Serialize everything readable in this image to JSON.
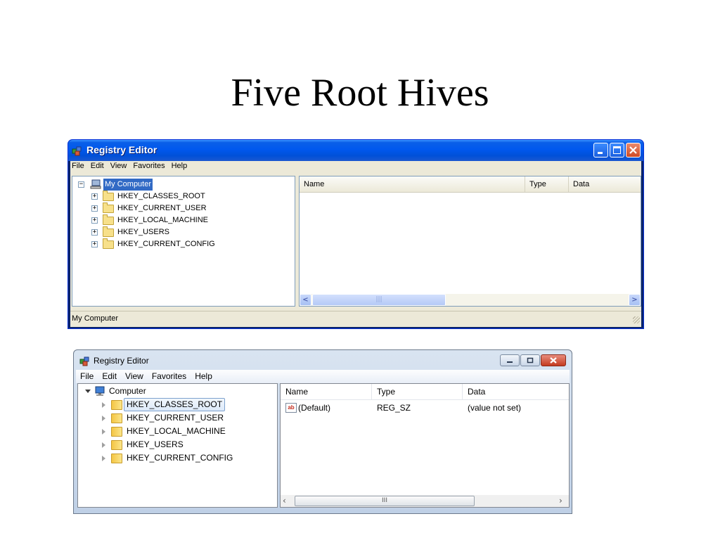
{
  "slide": {
    "title": "Five Root Hives"
  },
  "xp": {
    "title": "Registry Editor",
    "menu": [
      "File",
      "Edit",
      "View",
      "Favorites",
      "Help"
    ],
    "tree_root": "My Computer",
    "hives": [
      "HKEY_CLASSES_ROOT",
      "HKEY_CURRENT_USER",
      "HKEY_LOCAL_MACHINE",
      "HKEY_USERS",
      "HKEY_CURRENT_CONFIG"
    ],
    "columns": [
      "Name",
      "Type",
      "Data"
    ],
    "scroll_left": "<",
    "scroll_right": ">",
    "thumb_grip": "|||",
    "status": "My Computer",
    "colors": {
      "titlebar": "#0058ee",
      "selection": "#316ac5",
      "chrome": "#ece9d8"
    }
  },
  "vista": {
    "title": "Registry Editor",
    "menu": [
      "File",
      "Edit",
      "View",
      "Favorites",
      "Help"
    ],
    "tree_root": "Computer",
    "hives": [
      "HKEY_CLASSES_ROOT",
      "HKEY_CURRENT_USER",
      "HKEY_LOCAL_MACHINE",
      "HKEY_USERS",
      "HKEY_CURRENT_CONFIG"
    ],
    "columns": [
      "Name",
      "Type",
      "Data"
    ],
    "row": {
      "icon": "ab",
      "name": "(Default)",
      "type": "REG_SZ",
      "data": "(value not set)"
    },
    "scroll_left": "‹",
    "scroll_right": "›",
    "thumb_grip": "III",
    "colors": {
      "frame": "#bfd0e6",
      "close": "#c43b1f"
    }
  }
}
